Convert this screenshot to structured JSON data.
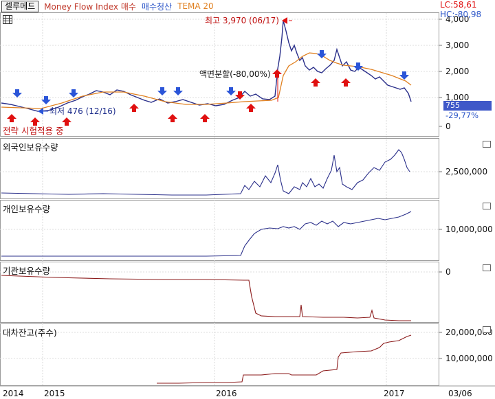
{
  "header": {
    "stock_name": "셀루메드",
    "legend_mfi": "Money Flow Index 매수",
    "legend_close": "매수청산",
    "legend_tema": "TEMA 20",
    "lc_label": "LC:58,61",
    "hc_label": "HC:-80,98"
  },
  "annotations": {
    "high_label": "최고 3,970 (06/17)",
    "low_label": "최저 476 (12/16)",
    "split_label": "액면분할(-80,00%)",
    "strategy_label": "전략 시험적용 중"
  },
  "current": {
    "price": "755",
    "change": "-29,77%"
  },
  "panes": {
    "price": {
      "ticks": [
        "3,000",
        "2,000",
        "1,000",
        "0"
      ],
      "top_tick": "4,000"
    },
    "foreign": {
      "title": "외국인보유수량",
      "ticks": [
        "2,500,000"
      ]
    },
    "retail": {
      "title": "개인보유수량",
      "ticks": [
        "10,000,000"
      ]
    },
    "institution": {
      "title": "기관보유수량",
      "ticks": [
        "0"
      ]
    },
    "loan": {
      "title": "대차잔고(주수)",
      "ticks": [
        "20,000,000",
        "10,000,000"
      ]
    }
  },
  "x_axis": {
    "labels": [
      "2014",
      "2015",
      "2016",
      "2017",
      "03/06"
    ]
  },
  "colors": {
    "price_line": "#2a2f8a",
    "tema": "#e08020",
    "buy_arrow": "#e01010",
    "sell_arrow": "#2b55d8",
    "inst_line": "#8b1a1a",
    "bg": "#ffffff"
  }
}
